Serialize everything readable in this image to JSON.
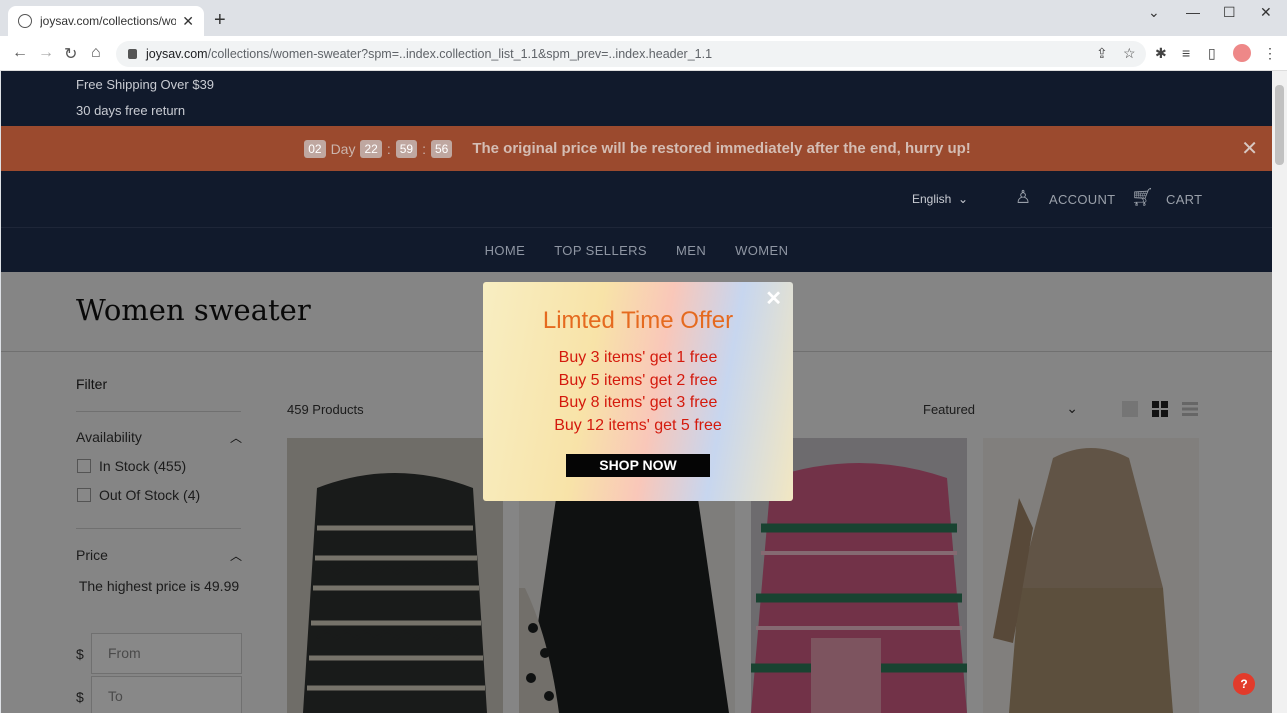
{
  "browser": {
    "tab_title": "joysav.com/collections/women-s",
    "url_host": "joysav.com",
    "url_path": "/collections/women-sweater?spm=..index.collection_list_1.1&spm_prev=..index.header_1.1"
  },
  "topbar": {
    "line1": "Free Shipping Over $39",
    "line2": "30 days free return"
  },
  "promo": {
    "days": "02",
    "day_label": "Day",
    "hours": "22",
    "minutes": "59",
    "seconds": "56",
    "message": "The original price will be restored immediately after the end, hurry up!"
  },
  "header": {
    "language": "English",
    "account": "ACCOUNT",
    "cart": "CART"
  },
  "nav": [
    "HOME",
    "TOP SELLERS",
    "MEN",
    "WOMEN"
  ],
  "collection": {
    "title": "Women sweater",
    "product_count": "459 Products",
    "sort": "Featured"
  },
  "filter": {
    "title": "Filter",
    "availability": "Availability",
    "in_stock": "In Stock (455)",
    "out_of_stock": "Out Of Stock (4)",
    "price": "Price",
    "price_note": "The highest price is 49.99",
    "currency": "$",
    "from_placeholder": "From",
    "to_placeholder": "To"
  },
  "modal": {
    "title": "Limted Time Offer",
    "offers": [
      "Buy 3 items' get 1 free",
      "Buy 5 items' get 2 free",
      "Buy 8 items' get 3 free",
      "Buy 12 items' get 5 free"
    ],
    "button": "SHOP NOW"
  },
  "products": [
    {
      "image": "striped knit sweater"
    },
    {
      "image": "black sweater with leopard sleeves"
    },
    {
      "image": "pink fair isle sweater"
    },
    {
      "image": "beige turtleneck sweater"
    }
  ]
}
